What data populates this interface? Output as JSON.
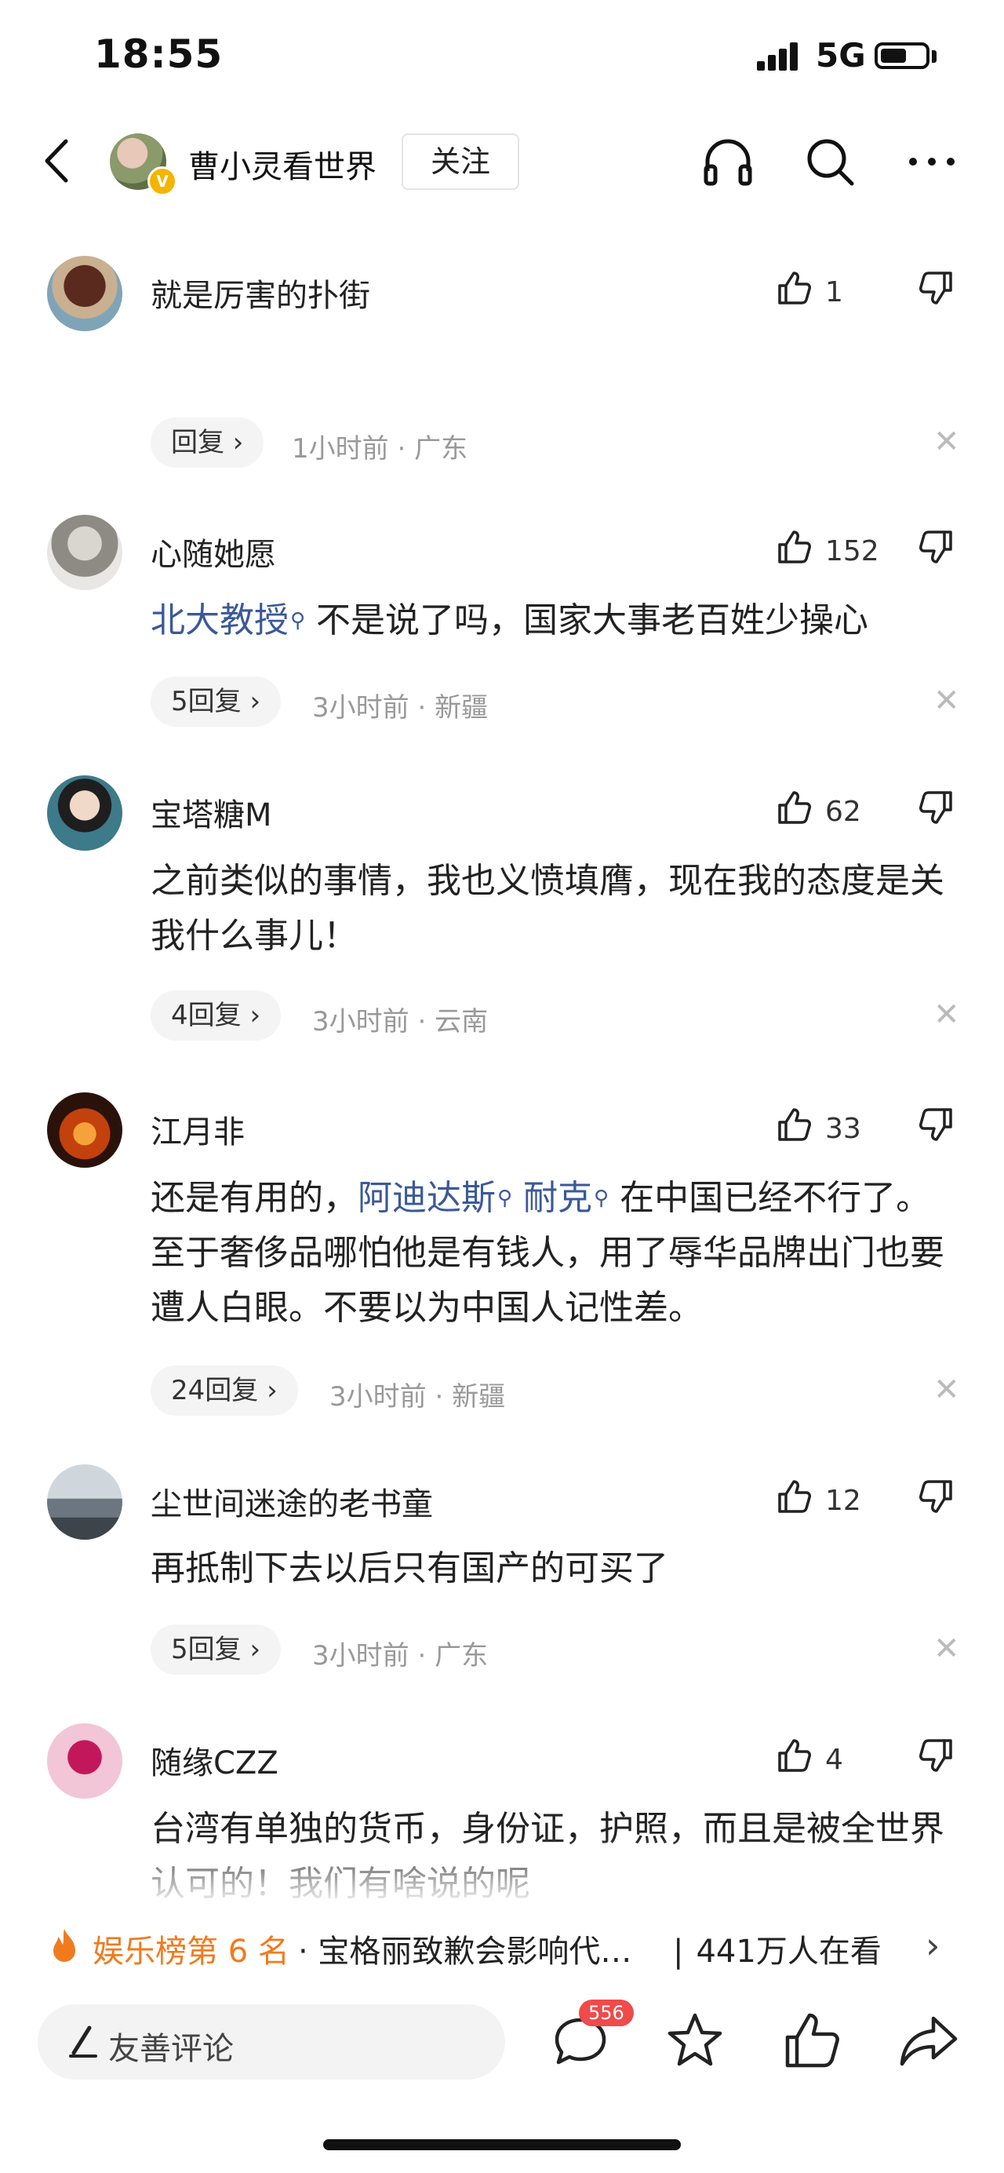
{
  "status_bar": {
    "time": "18:55",
    "network": "5G",
    "battery_level": 0.6
  },
  "header": {
    "title": "曹小灵看世界",
    "follow_label": "关注",
    "verified_mark": "V"
  },
  "comments": [
    {
      "name": "就是厉害的扑街",
      "text": [],
      "likes": "1",
      "reply_label": "回复 ›",
      "time": "1小时前",
      "location": "广东"
    },
    {
      "name": "心随她愿",
      "text": [
        {
          "t": "北大教授",
          "tag": true
        },
        {
          "t": " 不是说了吗，国家大事老百姓少操心",
          "tag": false
        }
      ],
      "likes": "152",
      "reply_label": "5回复 ›",
      "time": "3小时前",
      "location": "新疆"
    },
    {
      "name": "宝塔糖M",
      "text": [
        {
          "t": "之前类似的事情，我也义愤填膺，现在我的态度是关我什么事儿！",
          "tag": false
        }
      ],
      "likes": "62",
      "reply_label": "4回复 ›",
      "time": "3小时前",
      "location": "云南"
    },
    {
      "name": "江月非",
      "text": [
        {
          "t": "还是有用的，",
          "tag": false
        },
        {
          "t": "阿迪达斯",
          "tag": true
        },
        {
          "t": " ",
          "tag": false
        },
        {
          "t": "耐克",
          "tag": true
        },
        {
          "t": " 在中国已经不行了。至于奢侈品哪怕他是有钱人，用了辱华品牌出门也要遭人白眼。不要以为中国人记性差。",
          "tag": false
        }
      ],
      "likes": "33",
      "reply_label": "24回复 ›",
      "time": "3小时前",
      "location": "新疆"
    },
    {
      "name": "尘世间迷途的老书童",
      "text": [
        {
          "t": "再抵制下去以后只有国产的可买了",
          "tag": false
        }
      ],
      "likes": "12",
      "reply_label": "5回复 ›",
      "time": "3小时前",
      "location": "广东"
    },
    {
      "name": "随缘CZZ",
      "text": [
        {
          "t": "台湾有单独的货币，身份证，护照，而且是被全世界认可的！我们有啥说的呢",
          "tag": false
        }
      ],
      "likes": "4",
      "reply_label": "",
      "time": "",
      "location": ""
    }
  ],
  "hot_bar": {
    "rank": "娱乐榜第 6 名",
    "title": "· 宝格丽致歉会影响代…",
    "separator": "|",
    "viewers": "441万人在看",
    "arrow": "›"
  },
  "bottom_bar": {
    "placeholder": "友善评论",
    "comment_count": "556"
  },
  "colors": {
    "tag_link": "#3b5998",
    "hot_orange": "#f07b1e",
    "badge_red": "#f04a4a",
    "meta_gray": "#999999"
  },
  "icons": [
    "back-arrow-icon",
    "search-icon",
    "headphones-icon",
    "more-icon",
    "thumbs-up-icon",
    "thumbs-down-icon",
    "close-icon",
    "fire-icon",
    "pen-icon",
    "comment-bubble-icon",
    "star-icon",
    "share-icon"
  ]
}
